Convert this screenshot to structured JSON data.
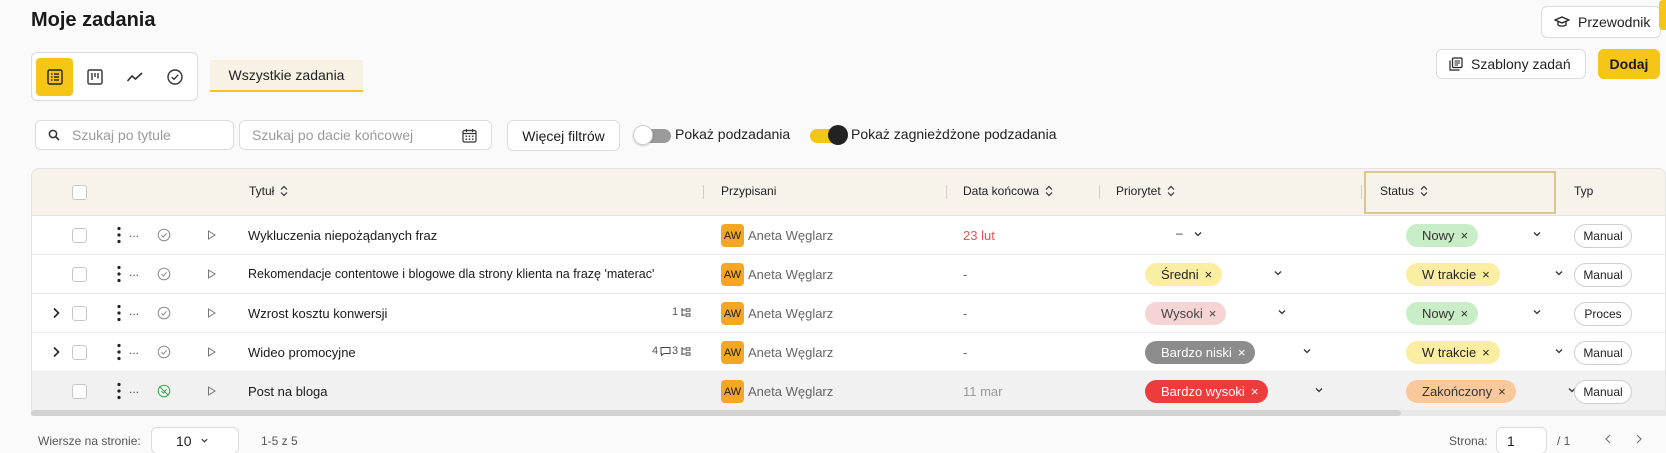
{
  "page": {
    "title": "Moje zadania"
  },
  "header": {
    "guide_label": "Przewodnik"
  },
  "views": {
    "active": "list",
    "items": [
      {
        "name": "list-view-icon"
      },
      {
        "name": "kanban-view-icon"
      },
      {
        "name": "chart-view-icon"
      },
      {
        "name": "completed-view-icon"
      }
    ]
  },
  "tabs": {
    "all_tasks": "Wszystkie zadania"
  },
  "actions": {
    "templates_label": "Szablony zadań",
    "add_label": "Dodaj"
  },
  "filters": {
    "title_search_placeholder": "Szukaj po tytule",
    "date_search_placeholder": "Szukaj po dacie końcowej",
    "more_filters_label": "Więcej filtrów",
    "show_subtasks_label": "Pokaż podzadania",
    "show_subtasks_on": false,
    "show_nested_label": "Pokaż zagnieżdżone podzadania",
    "show_nested_on": true
  },
  "table": {
    "columns": {
      "title": "Tytuł",
      "assignees": "Przypisani",
      "due": "Data końcowa",
      "priority": "Priorytet",
      "status": "Status",
      "type": "Typ"
    },
    "rows": [
      {
        "title": "Wykluczenia niepożądanych fraz",
        "avatar": "AW",
        "assignee": "Aneta Węglarz",
        "due": "23 lut",
        "priority": "–",
        "status": "Nowy",
        "type": "Manual",
        "expandable": false,
        "meta_subtasks": "",
        "meta_comments": ""
      },
      {
        "title": "Rekomendacje contentowe i blogowe dla strony klienta na frazę 'materac'",
        "avatar": "AW",
        "assignee": "Aneta Węglarz",
        "due": "-",
        "priority": "Średni",
        "status": "W trakcie",
        "type": "Manual",
        "expandable": false,
        "meta_subtasks": "",
        "meta_comments": ""
      },
      {
        "title": "Wzrost kosztu konwersji",
        "avatar": "AW",
        "assignee": "Aneta Węglarz",
        "due": "-",
        "priority": "Wysoki",
        "status": "Nowy",
        "type": "Proces",
        "expandable": true,
        "meta_subtasks": "1",
        "meta_comments": ""
      },
      {
        "title": "Wideo promocyjne",
        "avatar": "AW",
        "assignee": "Aneta Węglarz",
        "due": "-",
        "priority": "Bardzo niski",
        "status": "W trakcie",
        "type": "Manual",
        "expandable": true,
        "meta_subtasks": "3",
        "meta_comments": "4"
      },
      {
        "title": "Post na bloga",
        "avatar": "AW",
        "assignee": "Aneta Węglarz",
        "due": "11 mar",
        "priority": "Bardzo wysoki",
        "status": "Zakończony",
        "type": "Manual",
        "expandable": false,
        "meta_subtasks": "",
        "meta_comments": ""
      }
    ]
  },
  "pagination": {
    "rows_per_page_label": "Wiersze na stronie:",
    "rows_per_page": "10",
    "range_label": "1-5 z 5",
    "page_label": "Strona:",
    "current_page": "1",
    "total_pages": "/ 1"
  },
  "colors": {
    "accent": "#f5c518",
    "overdue": "#e25555"
  }
}
